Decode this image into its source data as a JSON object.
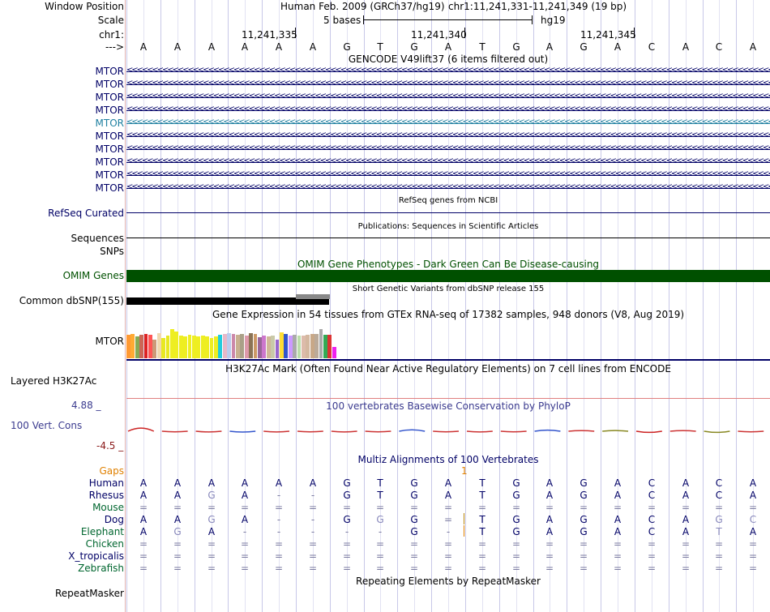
{
  "header": {
    "window_position_label": "Window Position",
    "assembly_title": "Human Feb. 2009 (GRCh37/hg19)",
    "position_text": "chr1:11,241,331-11,241,349 (19 bp)",
    "scale_label": "Scale",
    "scale_bar_label": "5 bases",
    "assembly_tag": "hg19",
    "chrom_label": "chr1:",
    "arrow_label": "--->",
    "ruler_ticks": [
      "11,241,335",
      "11,241,340",
      "11,241,345"
    ]
  },
  "sequence": [
    "A",
    "A",
    "A",
    "A",
    "A",
    "A",
    "G",
    "T",
    "G",
    "A",
    "T",
    "G",
    "A",
    "G",
    "A",
    "C",
    "A",
    "C",
    "A"
  ],
  "gencode": {
    "title": "GENCODE V49lift37 (6 items filtered out)",
    "genes": [
      "MTOR",
      "MTOR",
      "MTOR",
      "MTOR",
      "MTOR",
      "MTOR",
      "MTOR",
      "MTOR",
      "MTOR",
      "MTOR"
    ],
    "strand_glyph": "<"
  },
  "refseq": {
    "title": "RefSeq genes from NCBI",
    "label": "RefSeq Curated"
  },
  "publications": {
    "title": "Publications: Sequences in Scientific Articles",
    "label": "Sequences"
  },
  "snps_label": "SNPs",
  "omim": {
    "title": "OMIM Gene Phenotypes - Dark Green Can Be Disease-causing",
    "label": "OMIM Genes",
    "color": "#005000"
  },
  "dbsnp": {
    "title": "Short Genetic Variants from dbSNP release 155",
    "label": "Common dbSNP(155)"
  },
  "gtex": {
    "title": "Gene Expression in 54 tissues from GTEx RNA-seq of 17382 samples, 948 donors (V8, Aug 2019)",
    "gene_label": "MTOR",
    "tissue_colors": [
      "#ff9933",
      "#ffaa33",
      "#88aa55",
      "#cc6655",
      "#dd2222",
      "#ff5555",
      "#cc9977",
      "#f0d8b0",
      "#e8e822",
      "#e8e822",
      "#eeee22",
      "#eeee22",
      "#eeee22",
      "#eeee22",
      "#eeee22",
      "#eeee22",
      "#eeee22",
      "#eeee22",
      "#eeee22",
      "#eeee22",
      "#eeee22",
      "#22ccdd",
      "#e8b8c8",
      "#bbccee",
      "#cc88aa",
      "#c8b090",
      "#aaa088",
      "#dd99aa",
      "#8b7355",
      "#cc9966",
      "#996699",
      "#cc77cc",
      "#d0b898",
      "#c9c9a8",
      "#9966cc",
      "#ffdd33",
      "#3355cc",
      "#cc99ff",
      "#aaaaaa",
      "#bbddaa",
      "#ddbbaa",
      "#d4b8a0",
      "#c8a888",
      "#bbaa99",
      "#aaaaaa",
      "#33aa55",
      "#dd3333",
      "#ee22ee"
    ],
    "tissue_levels": [
      0.62,
      0.65,
      0.58,
      0.64,
      0.66,
      0.62,
      0.5,
      0.68,
      0.55,
      0.6,
      0.78,
      0.72,
      0.6,
      0.58,
      0.62,
      0.6,
      0.58,
      0.6,
      0.58,
      0.55,
      0.58,
      0.62,
      0.65,
      0.68,
      0.66,
      0.64,
      0.66,
      0.6,
      0.68,
      0.66,
      0.56,
      0.6,
      0.58,
      0.6,
      0.5,
      0.7,
      0.66,
      0.6,
      0.62,
      0.6,
      0.6,
      0.62,
      0.66,
      0.66,
      0.78,
      0.64,
      0.62,
      0.3
    ]
  },
  "h3k27ac": {
    "title": "H3K27Ac Mark (Often Found Near Active Regulatory Elements) on 7 cell lines from ENCODE",
    "label": "Layered H3K27Ac"
  },
  "phylop": {
    "title": "100 vertebrates Basewise Conservation by PhyloP",
    "label": "100 Vert. Cons",
    "max_label": "4.88 _",
    "min_label": "-4.5 _",
    "values": [
      0.55,
      -0.1,
      -0.12,
      -0.15,
      -0.12,
      -0.1,
      -0.12,
      -0.1,
      0.25,
      -0.1,
      -0.12,
      -0.1,
      0.2,
      0.1,
      0.12,
      -0.2,
      0.1,
      -0.2,
      -0.1
    ]
  },
  "multiz": {
    "title": "Multiz Alignments of 100 Vertebrates",
    "gaps_label": "Gaps",
    "gap_count": "1",
    "species": [
      {
        "name": "Human",
        "bases": [
          "A",
          "A",
          "A",
          "A",
          "A",
          "A",
          "G",
          "T",
          "G",
          "A",
          "T",
          "G",
          "A",
          "G",
          "A",
          "C",
          "A",
          "C",
          "A"
        ]
      },
      {
        "name": "Rhesus",
        "bases": [
          "A",
          "A",
          "G",
          "A",
          "-",
          "-",
          "G",
          "T",
          "G",
          "A",
          "T",
          "G",
          "A",
          "G",
          "A",
          "C",
          "A",
          "C",
          "A"
        ]
      },
      {
        "name": "Mouse",
        "bases": [
          "=",
          "=",
          "=",
          "=",
          "=",
          "=",
          "=",
          "=",
          "=",
          "=",
          "=",
          "=",
          "=",
          "=",
          "=",
          "=",
          "=",
          "=",
          "="
        ]
      },
      {
        "name": "Dog",
        "bases": [
          "A",
          "A",
          "G",
          "A",
          "-",
          "-",
          "G",
          "G",
          "G",
          "=",
          "T",
          "G",
          "A",
          "G",
          "A",
          "C",
          "A",
          "G",
          "C"
        ]
      },
      {
        "name": "Elephant",
        "bases": [
          "A",
          "G",
          "A",
          "-",
          "-",
          "-",
          "-",
          "-",
          "G",
          "-",
          "T",
          "G",
          "A",
          "G",
          "A",
          "C",
          "A",
          "T",
          "A"
        ]
      },
      {
        "name": "Chicken",
        "bases": [
          "=",
          "=",
          "=",
          "=",
          "=",
          "=",
          "=",
          "=",
          "=",
          "=",
          "=",
          "=",
          "=",
          "=",
          "=",
          "=",
          "=",
          "=",
          "="
        ]
      },
      {
        "name": "X_tropicalis",
        "bases": [
          "=",
          "=",
          "=",
          "=",
          "=",
          "=",
          "=",
          "=",
          "=",
          "=",
          "=",
          "=",
          "=",
          "=",
          "=",
          "=",
          "=",
          "=",
          "="
        ]
      },
      {
        "name": "Zebrafish",
        "bases": [
          "=",
          "=",
          "=",
          "=",
          "=",
          "=",
          "=",
          "=",
          "=",
          "=",
          "=",
          "=",
          "=",
          "=",
          "=",
          "=",
          "=",
          "=",
          "="
        ]
      }
    ]
  },
  "repeatmasker": {
    "title": "Repeating Elements by RepeatMasker",
    "label": "RepeatMasker"
  }
}
